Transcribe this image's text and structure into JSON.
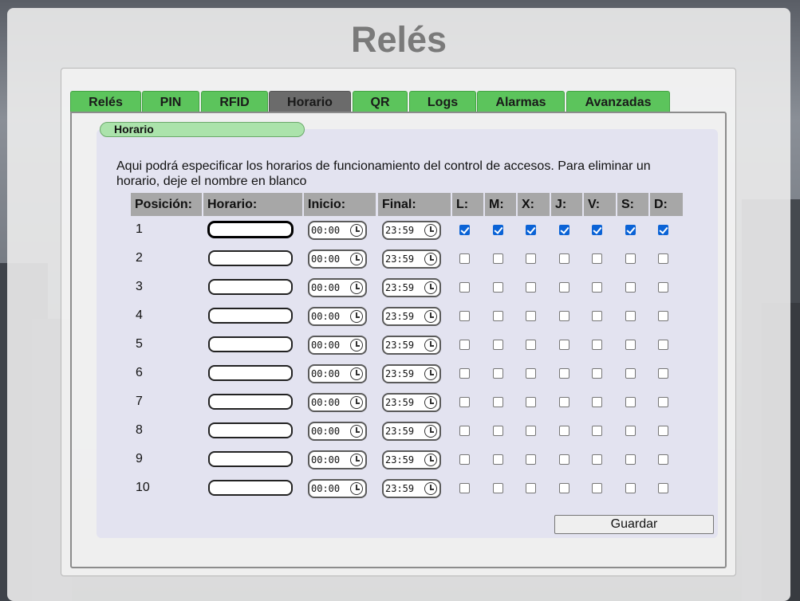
{
  "page": {
    "title": "Relés"
  },
  "tabs": [
    {
      "label": "Relés",
      "active": false
    },
    {
      "label": "PIN",
      "active": false
    },
    {
      "label": "RFID",
      "active": false
    },
    {
      "label": "Horario",
      "active": true
    },
    {
      "label": "QR",
      "active": false
    },
    {
      "label": "Logs",
      "active": false
    },
    {
      "label": "Alarmas",
      "active": false
    },
    {
      "label": "Avanzadas",
      "active": false
    }
  ],
  "section": {
    "title": "Horario",
    "description": "Aqui podrá especificar los horarios de funcionamiento del control de accesos. Para eliminar un horario, deje el nombre en blanco"
  },
  "table": {
    "headers": [
      "Posición:",
      "Horario:",
      "Inicio:",
      "Final:",
      "L:",
      "M:",
      "X:",
      "J:",
      "V:",
      "S:",
      "D:"
    ],
    "rows": [
      {
        "position": "1",
        "name": "",
        "start": "00:00",
        "end": "23:59",
        "days": [
          true,
          true,
          true,
          true,
          true,
          true,
          true
        ]
      },
      {
        "position": "2",
        "name": "",
        "start": "00:00",
        "end": "23:59",
        "days": [
          false,
          false,
          false,
          false,
          false,
          false,
          false
        ]
      },
      {
        "position": "3",
        "name": "",
        "start": "00:00",
        "end": "23:59",
        "days": [
          false,
          false,
          false,
          false,
          false,
          false,
          false
        ]
      },
      {
        "position": "4",
        "name": "",
        "start": "00:00",
        "end": "23:59",
        "days": [
          false,
          false,
          false,
          false,
          false,
          false,
          false
        ]
      },
      {
        "position": "5",
        "name": "",
        "start": "00:00",
        "end": "23:59",
        "days": [
          false,
          false,
          false,
          false,
          false,
          false,
          false
        ]
      },
      {
        "position": "6",
        "name": "",
        "start": "00:00",
        "end": "23:59",
        "days": [
          false,
          false,
          false,
          false,
          false,
          false,
          false
        ]
      },
      {
        "position": "7",
        "name": "",
        "start": "00:00",
        "end": "23:59",
        "days": [
          false,
          false,
          false,
          false,
          false,
          false,
          false
        ]
      },
      {
        "position": "8",
        "name": "",
        "start": "00:00",
        "end": "23:59",
        "days": [
          false,
          false,
          false,
          false,
          false,
          false,
          false
        ]
      },
      {
        "position": "9",
        "name": "",
        "start": "00:00",
        "end": "23:59",
        "days": [
          false,
          false,
          false,
          false,
          false,
          false,
          false
        ]
      },
      {
        "position": "10",
        "name": "",
        "start": "00:00",
        "end": "23:59",
        "days": [
          false,
          false,
          false,
          false,
          false,
          false,
          false
        ]
      }
    ]
  },
  "actions": {
    "save_label": "Guardar"
  },
  "colors": {
    "tab_green": "#5cc45c",
    "tab_active": "#6b6b6b",
    "pill_green": "#abe3ab",
    "checkbox_blue": "#0b63d6"
  },
  "icons": {
    "time_picker": "clock-icon"
  }
}
